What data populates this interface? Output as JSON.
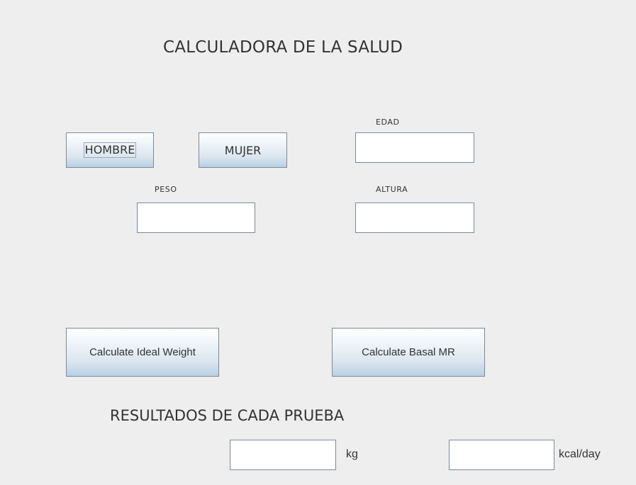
{
  "header": {
    "title": "CALCULADORA DE LA SALUD"
  },
  "gender": {
    "male_label": "HOMBRE",
    "female_label": "MUJER"
  },
  "inputs": {
    "age_label": "EDAD",
    "age_value": "",
    "weight_label": "PESO",
    "weight_value": "",
    "height_label": "ALTURA",
    "height_value": ""
  },
  "actions": {
    "ideal_weight_label": "Calculate Ideal Weight",
    "basal_mr_label": "Calculate Basal MR"
  },
  "results": {
    "title": "RESULTADOS DE CADA PRUEBA",
    "ideal_weight_value": "",
    "ideal_weight_unit": "kg",
    "basal_mr_value": "",
    "basal_mr_unit": "kcal/day"
  }
}
